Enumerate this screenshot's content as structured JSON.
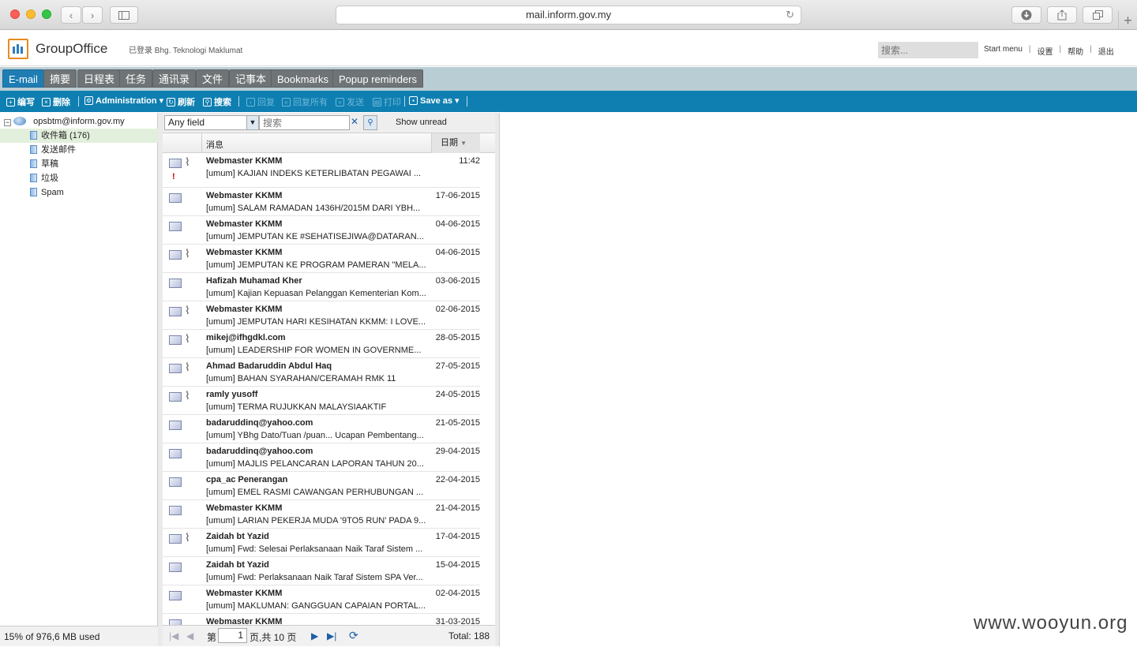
{
  "browser": {
    "url": "mail.inform.gov.my",
    "back": "‹",
    "forward": "›",
    "reload": "↻",
    "new_tab": "+"
  },
  "app": {
    "logo_text": "GroupOffice",
    "login_info": "已登录 Bhg. Teknologi Maklumat",
    "search_placeholder": "搜索...",
    "links": [
      "Start menu",
      "设置",
      "帮助",
      "退出"
    ]
  },
  "tabs": [
    "E-mail",
    "摘要",
    "日程表",
    "任务",
    "通讯录",
    "文件",
    "记事本",
    "Bookmarks",
    "Popup reminders"
  ],
  "toolbar": {
    "compose": "编写",
    "delete": "删除",
    "administration": "Administration",
    "refresh": "刷新",
    "search": "搜索",
    "reply": "回复",
    "reply_all": "回复所有",
    "forward": "发送",
    "print": "打印",
    "save_as": "Save as"
  },
  "sidebar": {
    "account": "opsbtm@inform.gov.my",
    "folders": [
      "收件箱 (176)",
      "发送邮件",
      "草稿",
      "垃圾",
      "Spam"
    ],
    "quota": "15% of 976,6 MB used"
  },
  "filter": {
    "field": "Any field",
    "search_placeholder": "搜索",
    "clear": "✕",
    "go": "⚲",
    "show_unread": "Show unread"
  },
  "columns": {
    "message": "消息",
    "date": "日期"
  },
  "messages": [
    {
      "from": "Webmaster KKMM",
      "subject": "[umum] KAJIAN INDEKS KETERLIBATAN PEGAWAI ...",
      "date": "11:42",
      "attach": true,
      "flag": true
    },
    {
      "from": "Webmaster KKMM",
      "subject": "[umum] SALAM RAMADAN 1436H/2015M DARI YBH...",
      "date": "17-06-2015",
      "attach": false,
      "flag": false
    },
    {
      "from": "Webmaster KKMM",
      "subject": "[umum] JEMPUTAN KE #SEHATISEJIWA@DATARAN...",
      "date": "04-06-2015",
      "attach": false,
      "flag": false
    },
    {
      "from": "Webmaster KKMM",
      "subject": "[umum] JEMPUTAN KE PROGRAM PAMERAN \"MELA...",
      "date": "04-06-2015",
      "attach": true,
      "flag": false
    },
    {
      "from": "Hafizah Muhamad Kher",
      "subject": "[umum] Kajian Kepuasan Pelanggan Kementerian Kom...",
      "date": "03-06-2015",
      "attach": false,
      "flag": false
    },
    {
      "from": "Webmaster KKMM",
      "subject": "[umum] JEMPUTAN HARI KESIHATAN KKMM: I LOVE...",
      "date": "02-06-2015",
      "attach": true,
      "flag": false
    },
    {
      "from": "mikej@ifhgdkl.com",
      "subject": "[umum] LEADERSHIP FOR WOMEN IN GOVERNME...",
      "date": "28-05-2015",
      "attach": true,
      "flag": false
    },
    {
      "from": "Ahmad Badaruddin Abdul Haq",
      "subject": "[umum] BAHAN SYARAHAN/CERAMAH RMK 11",
      "date": "27-05-2015",
      "attach": true,
      "flag": false
    },
    {
      "from": "ramly yusoff",
      "subject": "[umum] TERMA RUJUKKAN MALAYSIAAKTIF",
      "date": "24-05-2015",
      "attach": true,
      "flag": false
    },
    {
      "from": "badaruddinq@yahoo.com",
      "subject": "[umum] YBhg Dato/Tuan /puan... Ucapan Pembentang...",
      "date": "21-05-2015",
      "attach": false,
      "flag": false
    },
    {
      "from": "badaruddinq@yahoo.com",
      "subject": "[umum] MAJLIS PELANCARAN LAPORAN TAHUN 20...",
      "date": "29-04-2015",
      "attach": false,
      "flag": false
    },
    {
      "from": "cpa_ac Penerangan",
      "subject": "[umum] EMEL RASMI CAWANGAN PERHUBUNGAN ...",
      "date": "22-04-2015",
      "attach": false,
      "flag": false
    },
    {
      "from": "Webmaster KKMM",
      "subject": "[umum] LARIAN PEKERJA MUDA '9TO5 RUN' PADA 9...",
      "date": "21-04-2015",
      "attach": false,
      "flag": false
    },
    {
      "from": "Zaidah bt Yazid",
      "subject": "[umum] Fwd: Selesai Perlaksanaan Naik Taraf Sistem ...",
      "date": "17-04-2015",
      "attach": true,
      "flag": false
    },
    {
      "from": "Zaidah bt Yazid",
      "subject": "[umum] Fwd: Perlaksanaan Naik Taraf Sistem SPA Ver...",
      "date": "15-04-2015",
      "attach": false,
      "flag": false
    },
    {
      "from": "Webmaster KKMM",
      "subject": "[umum] MAKLUMAN: GANGGUAN CAPAIAN PORTAL...",
      "date": "02-04-2015",
      "attach": false,
      "flag": false
    },
    {
      "from": "Webmaster KKMM",
      "subject": "",
      "date": "31-03-2015",
      "attach": false,
      "flag": false
    }
  ],
  "pager": {
    "page_label": "第",
    "page": "1",
    "of_label": "页,共 10 页",
    "total": "Total: 188"
  },
  "watermark": "www.wooyun.org",
  "colors": {
    "accent": "#0f7fb1",
    "active_tab": "#1e7db3",
    "tab": "#6f7476"
  }
}
